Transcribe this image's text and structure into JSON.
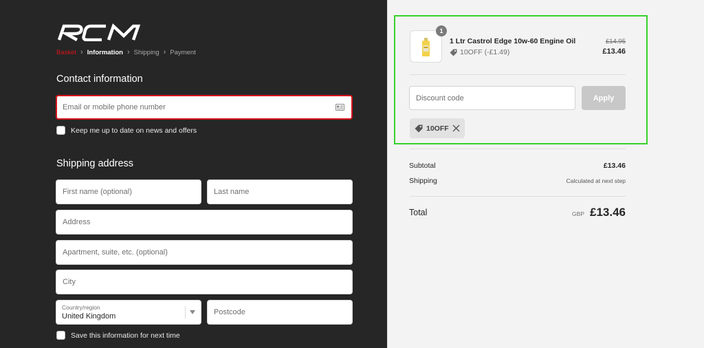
{
  "brand": {
    "logo_text": "RCM",
    "accent_color": "#d6141c"
  },
  "breadcrumb": [
    {
      "label": "Basket",
      "state": "link"
    },
    {
      "label": "Information",
      "state": "current"
    },
    {
      "label": "Shipping",
      "state": "upcoming"
    },
    {
      "label": "Payment",
      "state": "upcoming"
    }
  ],
  "contact": {
    "title": "Contact information",
    "email_placeholder": "Email or mobile phone number",
    "newsletter_label": "Keep me up to date on news and offers",
    "newsletter_checked": false
  },
  "shipping": {
    "title": "Shipping address",
    "first_name_placeholder": "First name (optional)",
    "last_name_placeholder": "Last name",
    "address_placeholder": "Address",
    "apartment_placeholder": "Apartment, suite, etc. (optional)",
    "city_placeholder": "City",
    "country_label": "Country/region",
    "country_value": "United Kingdom",
    "postcode_placeholder": "Postcode",
    "save_info_label": "Save this information for next time",
    "save_info_checked": false
  },
  "order": {
    "item": {
      "quantity": "1",
      "name": "1 Ltr Castrol Edge 10w-60 Engine Oil",
      "discount_text": "10OFF (-£1.49)",
      "original_price": "£14.95",
      "price": "£13.46"
    },
    "discount_placeholder": "Discount code",
    "apply_label": "Apply",
    "applied_code": "10OFF",
    "subtotal_label": "Subtotal",
    "subtotal_value": "£13.46",
    "shipping_label": "Shipping",
    "shipping_value": "Calculated at next step",
    "total_label": "Total",
    "currency": "GBP",
    "total_value": "£13.46"
  },
  "colors": {
    "highlight": "#36d12c",
    "dark_panel": "#262626",
    "light_panel": "#f3f3f3"
  }
}
